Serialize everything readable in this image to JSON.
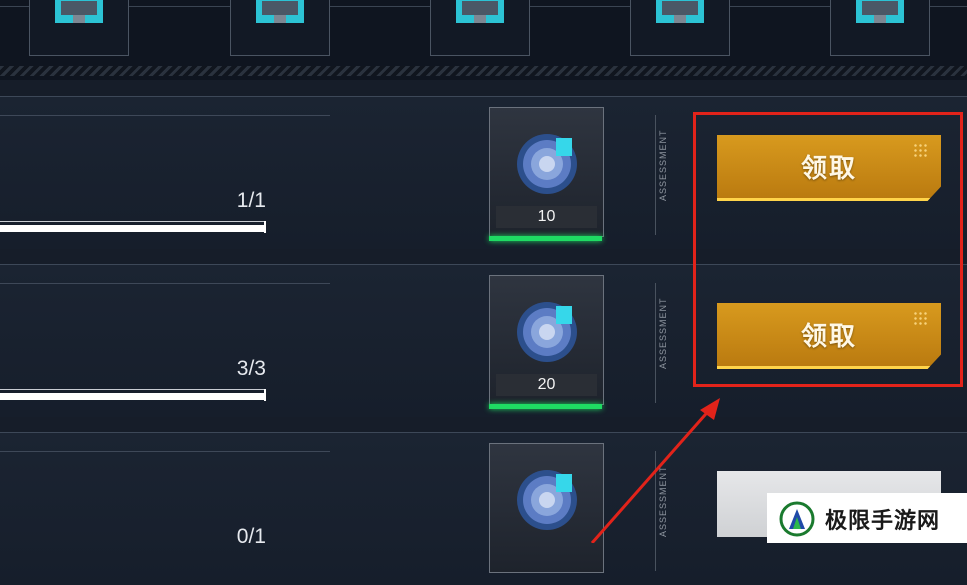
{
  "rows": [
    {
      "progress_text": "1/1",
      "progress_fraction": 1.0,
      "reward_qty": "10",
      "assessment_label": "ASSESSMENT",
      "button_label": "领取",
      "button_state": "claimable"
    },
    {
      "progress_text": "3/3",
      "progress_fraction": 1.0,
      "reward_qty": "20",
      "assessment_label": "ASSESSMENT",
      "button_label": "领取",
      "button_state": "claimable"
    },
    {
      "progress_text": "0/1",
      "progress_fraction": 0.0,
      "reward_qty": "",
      "assessment_label": "ASSESSMENT",
      "button_label": "",
      "button_state": "disabled"
    }
  ],
  "watermark": {
    "text": "极限手游网"
  },
  "colors": {
    "claim_button": "#c8891a",
    "highlight": "#e2231a",
    "reward_rarity": "#1fdb63"
  },
  "icons": {
    "reward_item": "medal-icon",
    "top_chest": "supply-crate-icon"
  }
}
